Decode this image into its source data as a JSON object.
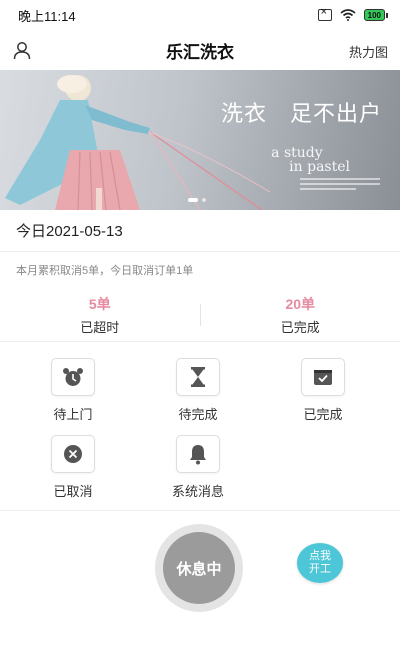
{
  "status_bar": {
    "time": "晚上11:14",
    "battery": "100"
  },
  "header": {
    "title": "乐汇洗衣",
    "heatmap_label": "热力图"
  },
  "banner": {
    "slogan": "洗衣　足不出户",
    "caption_line1": "a study",
    "caption_line2": "in pastel"
  },
  "date": "今日2021-05-13",
  "summary": "本月累积取消5单，今日取消订单1单",
  "stats": [
    {
      "value": "5单",
      "label": "已超时"
    },
    {
      "value": "20单",
      "label": "已完成"
    }
  ],
  "functions": [
    {
      "label": "待上门",
      "icon": "alarm-clock-icon"
    },
    {
      "label": "待完成",
      "icon": "hourglass-icon"
    },
    {
      "label": "已完成",
      "icon": "checked-box-icon"
    },
    {
      "label": "已取消",
      "icon": "cancel-icon"
    },
    {
      "label": "系统消息",
      "icon": "bell-icon"
    }
  ],
  "rest_button": "休息中",
  "start_button": "点我开工",
  "colors": {
    "accent_pink": "#e58aa0",
    "start_cyan": "#4dc6d8",
    "rest_gray": "#9b9b9b"
  }
}
